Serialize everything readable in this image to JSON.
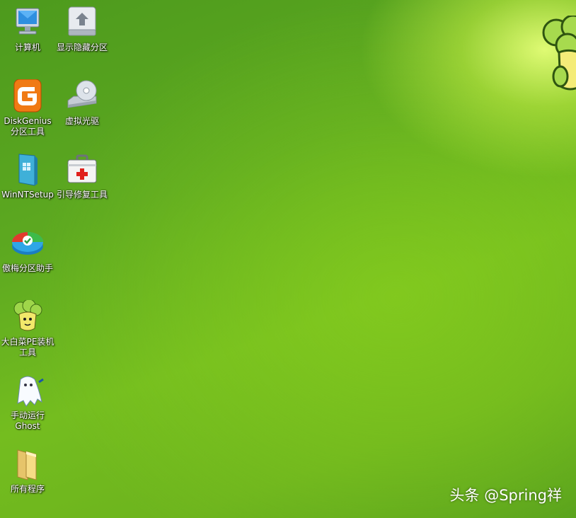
{
  "desktop": {
    "icons": [
      {
        "label": "计算机",
        "icon": "computer-icon"
      },
      {
        "label": "显示隐藏分区",
        "icon": "show-partition-icon"
      },
      {
        "label": "DiskGenius\n分区工具",
        "icon": "diskgenius-icon"
      },
      {
        "label": "虚拟光驱",
        "icon": "virtual-drive-icon"
      },
      {
        "label": "WinNTSetup",
        "icon": "winntsetup-icon"
      },
      {
        "label": "引导修复工具",
        "icon": "boot-repair-icon"
      },
      {
        "label": "傲梅分区助手",
        "icon": "aomei-partition-icon"
      },
      {
        "label": "大白菜PE装机\n工具",
        "icon": "dabaicai-installer-icon"
      },
      {
        "label": "手动运行\nGhost",
        "icon": "ghost-icon"
      },
      {
        "label": "所有程序",
        "icon": "folder-icon"
      }
    ],
    "watermark": "头条 @Spring祥"
  },
  "colors": {
    "background": "#6db41e",
    "label_text": "#ffffff"
  }
}
